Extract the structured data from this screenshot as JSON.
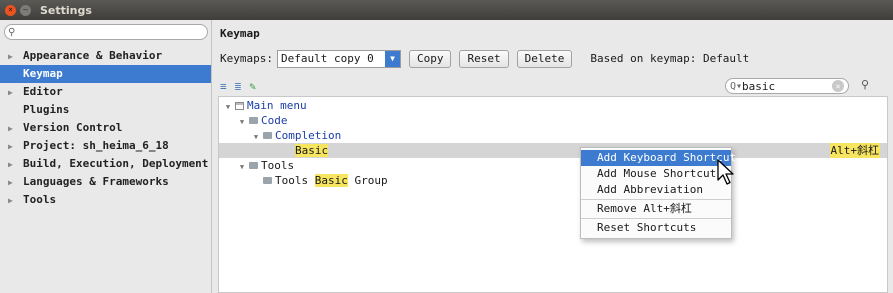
{
  "window": {
    "title": "Settings"
  },
  "sidebar": {
    "search_placeholder": "",
    "items": [
      {
        "label": "Appearance & Behavior",
        "expandable": true,
        "selected": false
      },
      {
        "label": "Keymap",
        "expandable": false,
        "selected": true
      },
      {
        "label": "Editor",
        "expandable": true,
        "selected": false
      },
      {
        "label": "Plugins",
        "expandable": false,
        "selected": false
      },
      {
        "label": "Version Control",
        "expandable": true,
        "selected": false
      },
      {
        "label": "Project: sh_heima_6_18",
        "expandable": true,
        "selected": false
      },
      {
        "label": "Build, Execution, Deployment",
        "expandable": true,
        "selected": false
      },
      {
        "label": "Languages & Frameworks",
        "expandable": true,
        "selected": false
      },
      {
        "label": "Tools",
        "expandable": true,
        "selected": false
      }
    ]
  },
  "main": {
    "title": "Keymap",
    "keymaps_label": "Keymaps:",
    "keymap_value": "Default copy 0",
    "copy_label": "Copy",
    "reset_label": "Reset",
    "delete_label": "Delete",
    "based_on": "Based on keymap: Default",
    "filter_value": "basic"
  },
  "tree": {
    "main_menu": "Main menu",
    "code": "Code",
    "completion": "Completion",
    "basic": "Basic",
    "basic_shortcut": "Alt+斜杠",
    "tools": "Tools",
    "tools_group_prefix": "Tools ",
    "tools_group_highlight": "Basic",
    "tools_group_suffix": " Group"
  },
  "context_menu": {
    "items": [
      "Add Keyboard Shortcut",
      "Add Mouse Shortcut",
      "Add Abbreviation",
      "Remove Alt+斜杠",
      "Reset Shortcuts"
    ]
  },
  "colors": {
    "accent": "#3c7bd0",
    "highlight": "#f7e560",
    "close_button": "#e95420"
  }
}
